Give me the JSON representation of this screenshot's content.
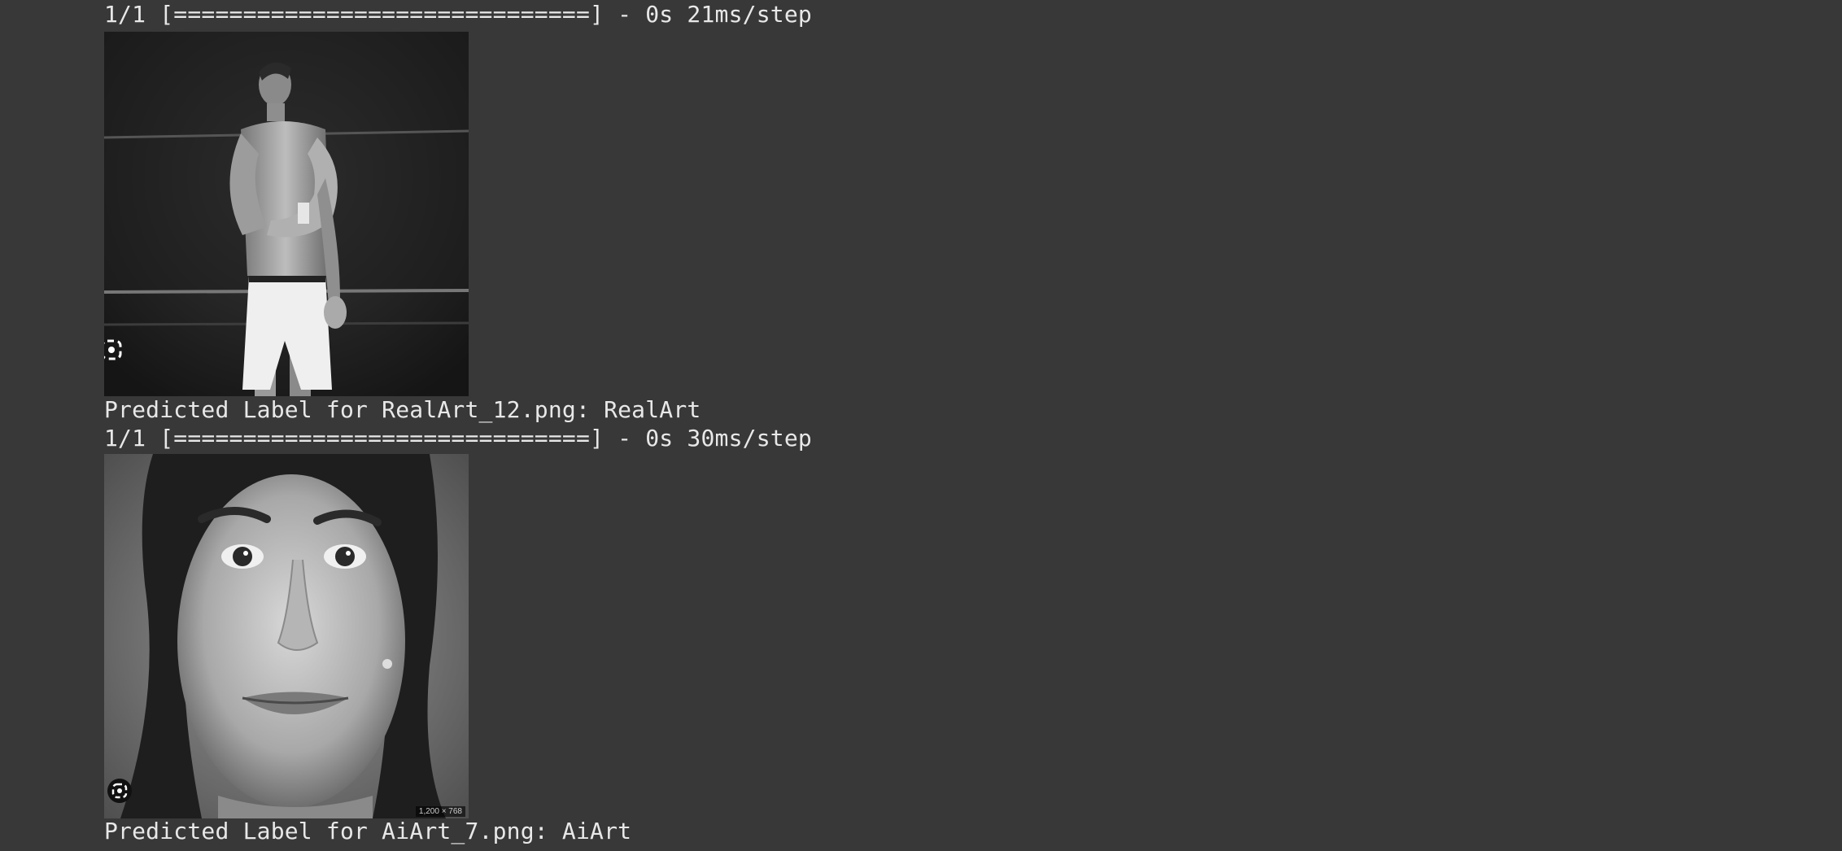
{
  "cells": [
    {
      "progress_line": "1/1 [==============================] - 0s 21ms/step",
      "image_subject": "black-and-white photo of a boxer in a ring",
      "prediction_line": "Predicted Label for RealArt_12.png: RealArt"
    },
    {
      "progress_line": "1/1 [==============================] - 0s 30ms/step",
      "image_subject": "black-and-white close-up portrait of a smiling woman",
      "image_corner_text": "1,200 × 768",
      "prediction_line": "Predicted Label for AiArt_7.png: AiArt"
    }
  ],
  "icons": {
    "lens": "lens-icon"
  },
  "colors": {
    "background": "#383838",
    "text": "#e8e8e8"
  }
}
